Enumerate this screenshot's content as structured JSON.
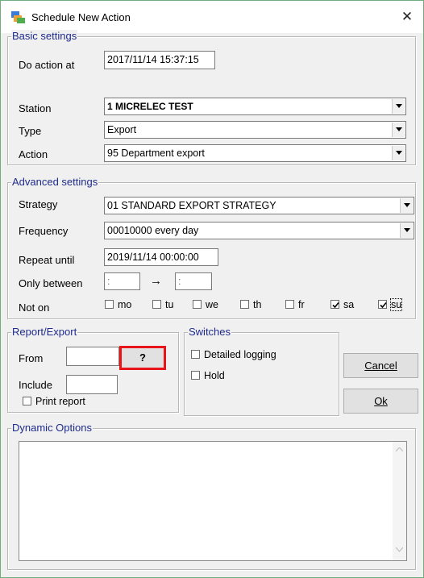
{
  "window": {
    "title": "Schedule New Action",
    "close_glyph": "✕"
  },
  "basic": {
    "legend": "Basic settings",
    "do_action_at_label": "Do action at",
    "do_action_at_value": "2017/11/14 15:37:15",
    "station_label": "Station",
    "station_value": "1  MICRELEC TEST",
    "type_label": "Type",
    "type_value": "Export",
    "action_label": "Action",
    "action_value": "95  Department export"
  },
  "advanced": {
    "legend": "Advanced settings",
    "strategy_label": "Strategy",
    "strategy_value": "01  STANDARD EXPORT STRATEGY",
    "frequency_label": "Frequency",
    "frequency_value": "00010000   every day",
    "repeat_until_label": "Repeat until",
    "repeat_until_value": "2019/11/14  00:00:00",
    "only_between_label": "Only between",
    "only_between_from": " :",
    "only_between_arrow": "→",
    "only_between_to": " :",
    "not_on_label": "Not on",
    "days": [
      {
        "label": "mo",
        "checked": false
      },
      {
        "label": "tu",
        "checked": false
      },
      {
        "label": "we",
        "checked": false
      },
      {
        "label": "th",
        "checked": false
      },
      {
        "label": "fr",
        "checked": false
      },
      {
        "label": "sa",
        "checked": true
      },
      {
        "label": "su",
        "checked": true
      }
    ]
  },
  "report": {
    "legend": "Report/Export",
    "from_label": "From",
    "from_value": "",
    "browse_label": "?",
    "include_label": "Include",
    "include_value": "",
    "print_report_label": "Print report",
    "print_report_checked": false
  },
  "switches": {
    "legend": "Switches",
    "detailed_logging_label": "Detailed logging",
    "hold_label": "Hold"
  },
  "buttons": {
    "cancel_label": "Cancel",
    "ok_label": "Ok"
  },
  "dynamic": {
    "legend": "Dynamic Options"
  },
  "colors": {
    "legend_text": "#1f2b8c",
    "highlight": "#e8141a",
    "window_border": "#6fae7b"
  }
}
